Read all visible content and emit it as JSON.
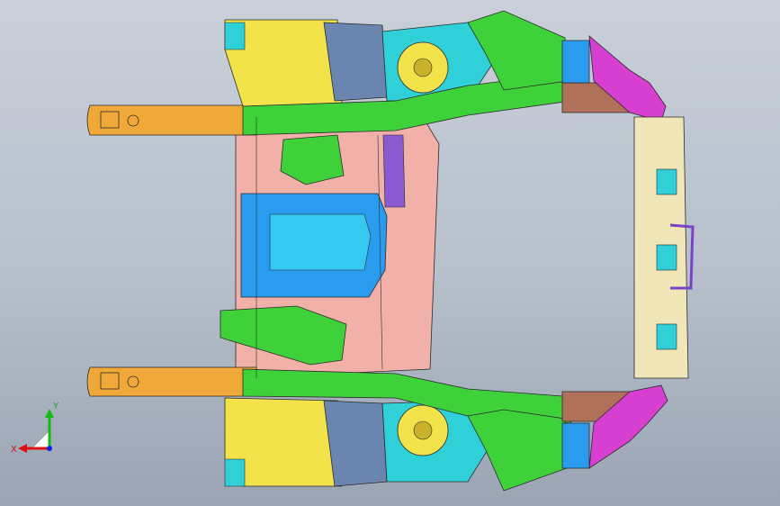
{
  "viewport": {
    "description_name": "3D CAD viewport",
    "colors": {
      "background_top": "#c9d0da",
      "background_bottom": "#9aa4b3",
      "rail_orange": "#f0a838",
      "yellow": "#f2e34a",
      "green": "#3fd13a",
      "cyan": "#2fd0d8",
      "blue": "#2a9cf0",
      "pink": "#f1b0a8",
      "magenta": "#d63fd0",
      "brown": "#b0705a",
      "cream": "#f1e6b8",
      "slate": "#6a86b0",
      "purple": "#7a42c8",
      "edge": "#2a2a2a"
    }
  },
  "triad": {
    "x_label": "X",
    "y_label": "Y",
    "x_color": "#dd1111",
    "y_color": "#11bb11",
    "z_color": "#1122dd"
  }
}
